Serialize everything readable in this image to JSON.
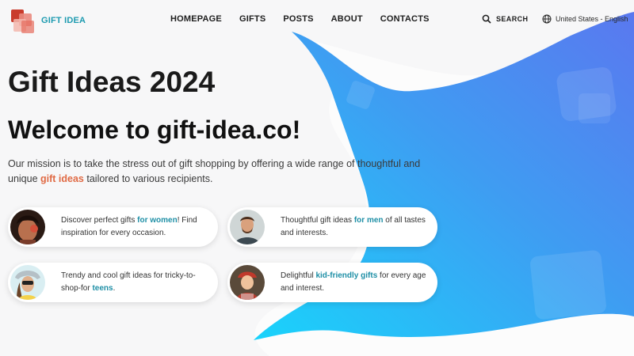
{
  "brand": {
    "name": "GIFT IDEA"
  },
  "nav": {
    "items": [
      "HOMEPAGE",
      "GIFTS",
      "POSTS",
      "ABOUT",
      "CONTACTS"
    ]
  },
  "header": {
    "search_label": "SEARCH",
    "locale_label": "United States - English"
  },
  "hero": {
    "title": "Gift Ideas 2024",
    "welcome": "Welcome to gift-idea.co!",
    "mission_prefix": "Our mission is to take the stress out of gift shopping by offering a wide range of thoughtful and unique ",
    "mission_highlight": "gift ideas",
    "mission_suffix": " tailored to various recipients."
  },
  "cards": [
    {
      "before": "Discover perfect gifts ",
      "highlight": "for women",
      "after": "! Find inspiration for every occasion.",
      "icon": "woman-avatar"
    },
    {
      "before": "Thoughtful gift ideas ",
      "highlight": "for men",
      "after": " of all tastes and interests.",
      "icon": "man-avatar"
    },
    {
      "before": "Trendy and cool gift ideas for tricky-to-shop-for ",
      "highlight": "teens",
      "after": ".",
      "icon": "teen-avatar"
    },
    {
      "before": "Delightful ",
      "highlight": "kid-friendly gifts",
      "after": " for every age and interest.",
      "icon": "kid-avatar"
    }
  ],
  "colors": {
    "accent": "#1e9bb0",
    "highlight": "#e06a44",
    "blob_start": "#1fc8f5",
    "blob_end": "#5a80f0"
  }
}
